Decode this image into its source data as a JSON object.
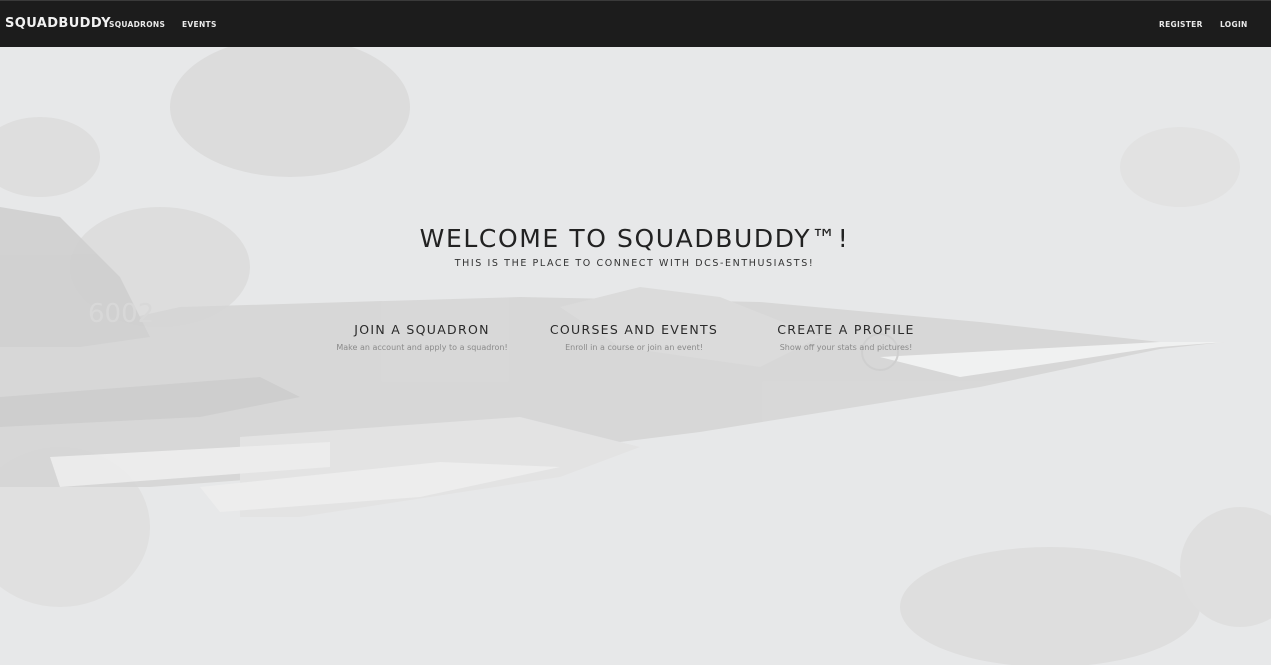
{
  "navbar": {
    "brand": "SQUADBUDDY",
    "links": {
      "squadrons": "SQUADRONS",
      "events": "EVENTS",
      "register": "REGISTER",
      "login": "LOGIN"
    }
  },
  "hero": {
    "title": "WELCOME TO SQUADBUDDY™!",
    "subtitle": "THIS IS THE PLACE TO CONNECT WITH DCS-ENTHUSIASTS!",
    "background_tail_number": "6002",
    "features": [
      {
        "title": "JOIN A SQUADRON",
        "description": "Make an account and apply to a squadron!"
      },
      {
        "title": "COURSES AND EVENTS",
        "description": "Enroll in a course or join an event!"
      },
      {
        "title": "CREATE A PROFILE",
        "description": "Show off your stats and pictures!"
      }
    ]
  },
  "colors": {
    "navbar_bg": "#1c1c1c",
    "hero_overlay": "#e9eaeb",
    "title_text": "#222222",
    "description_text": "#8a8a8a"
  }
}
